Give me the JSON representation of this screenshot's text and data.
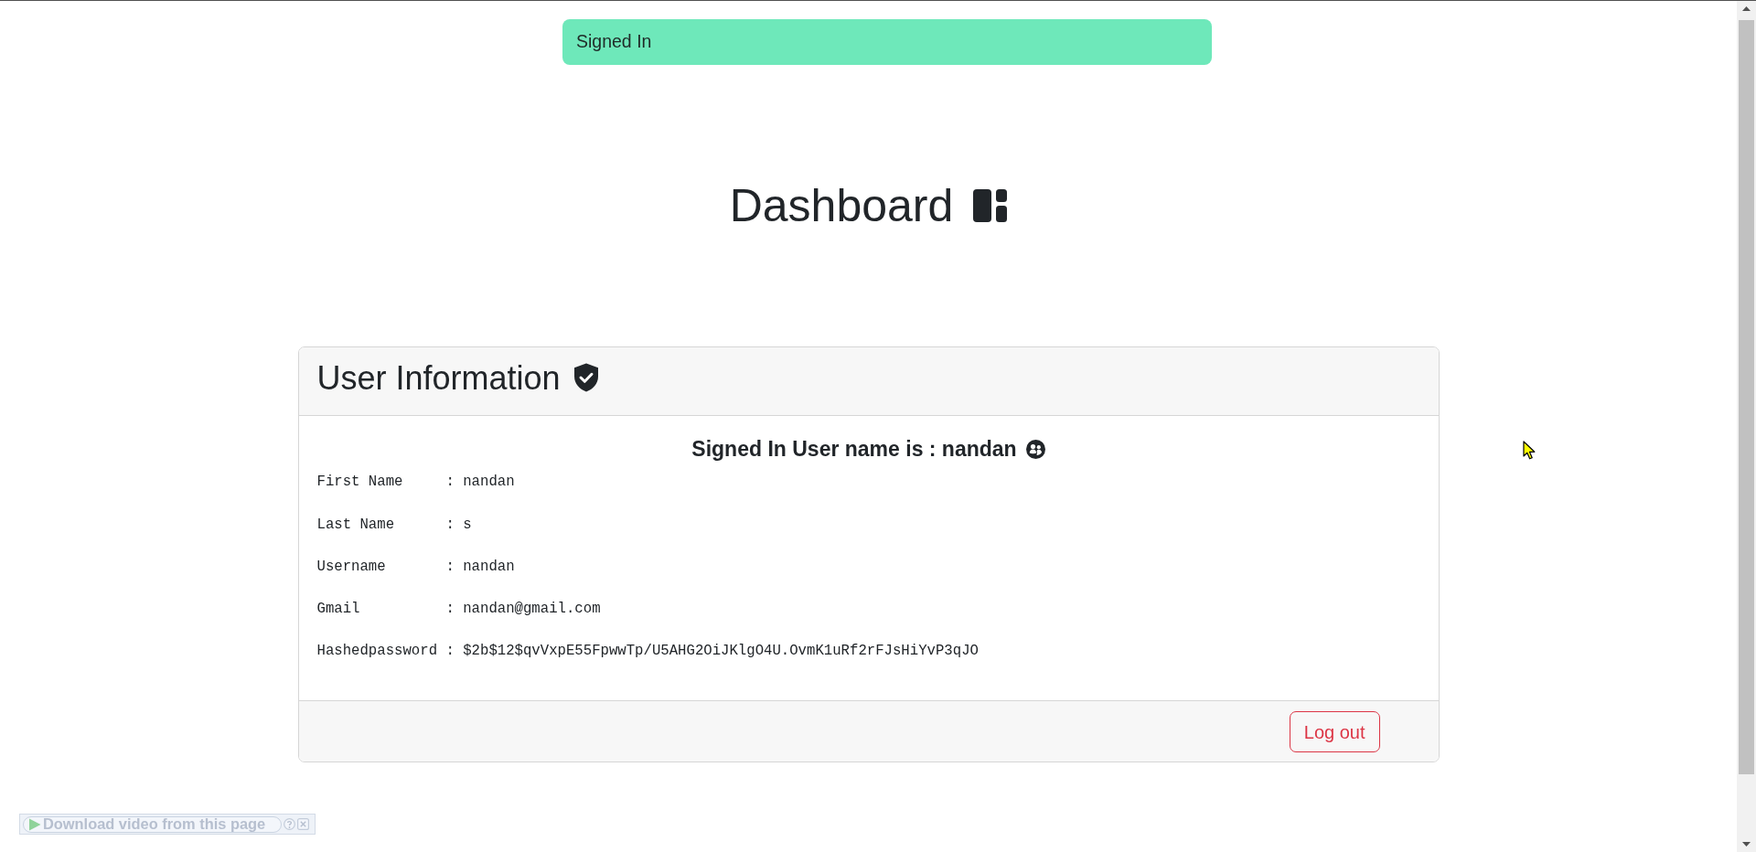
{
  "toast": {
    "message": "Signed In"
  },
  "page_title": "Dashboard",
  "user_card": {
    "title": "User Information",
    "greeting": "Signed In User name is : nandan",
    "fields": [
      {
        "label": "First Name",
        "separator": ":",
        "value": "nandan"
      },
      {
        "label": "Last Name",
        "separator": ":",
        "value": "s"
      },
      {
        "label": "Username",
        "separator": ":",
        "value": "nandan"
      },
      {
        "label": "Gmail",
        "separator": ":",
        "value": "nandan@gmail.com"
      },
      {
        "label": "Hashedpassword",
        "separator": ":",
        "value": "$2b$12$qvVxpE55FpwwTp/U5AHG2OiJKlgO4U.OvmK1uRf2rFJsHiYvP3qJO"
      }
    ],
    "footer_buttons": [
      "Log out"
    ]
  },
  "extension_bar": {
    "button_label": "Download video from this page"
  }
}
